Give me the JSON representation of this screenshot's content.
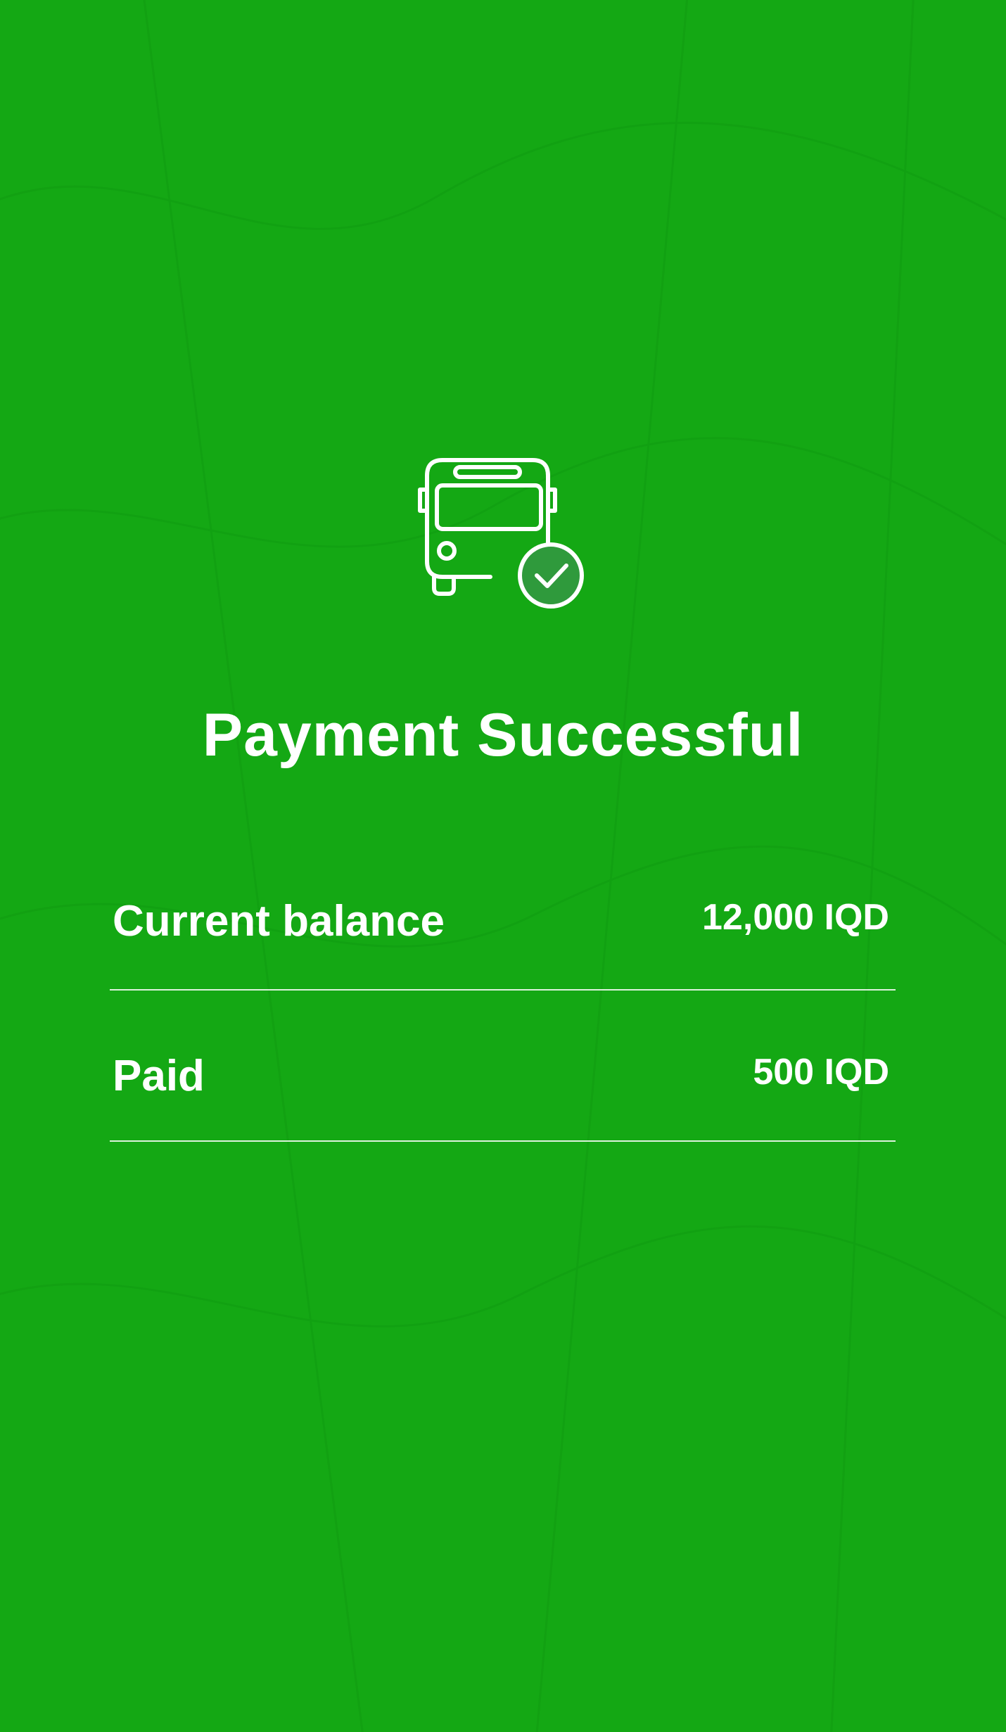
{
  "theme": {
    "background": "#14a814",
    "foreground": "#ffffff",
    "badge": "#2f9a3c"
  },
  "status": {
    "icon": "bus-check-icon",
    "title": "Payment Successful"
  },
  "details": [
    {
      "label": "Current balance",
      "value": "12,000 IQD"
    },
    {
      "label": "Paid",
      "value": "500 IQD"
    }
  ]
}
